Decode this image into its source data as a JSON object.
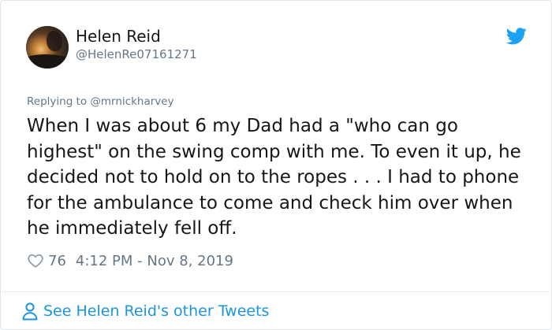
{
  "author": {
    "name": "Helen Reid",
    "handle": "@HelenRe07161271"
  },
  "reply_line": "Replying to @mrnickharvey",
  "tweet": {
    "text": "When I was about 6 my Dad had a \"who can go highest\" on the swing comp with me. To even it up, he decided not to hold on to the ropes . . . I had to phone for the ambulance to come and check him over when he immediately fell off."
  },
  "meta": {
    "likes": "76",
    "timestamp": "4:12 PM - Nov 8, 2019"
  },
  "footer": {
    "see_more": "See Helen Reid's other Tweets"
  },
  "icons": {
    "brand": "twitter-bird-icon",
    "like": "heart-icon",
    "profile": "person-icon"
  },
  "colors": {
    "twitter_blue": "#1da1f2",
    "link_blue": "#1b95e0",
    "secondary_text": "#657786",
    "primary_text": "#14171a",
    "border": "#e1e8ed"
  }
}
